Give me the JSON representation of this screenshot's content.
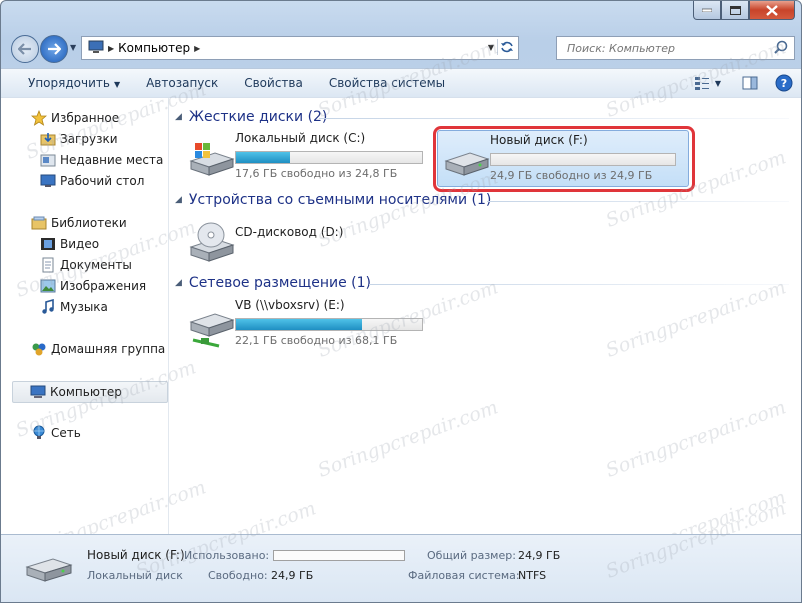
{
  "window": {
    "minimize_icon": "minimize-icon",
    "maximize_icon": "maximize-icon",
    "close_icon": "close-icon"
  },
  "address_bar": {
    "path": [
      "Компьютер"
    ],
    "search_placeholder": "Поиск: Компьютер"
  },
  "toolbar": {
    "organize": "Упорядочить",
    "autoplay": "Автозапуск",
    "properties": "Свойства",
    "system_properties": "Свойства системы"
  },
  "nav": {
    "favorites": "Избранное",
    "downloads": "Загрузки",
    "recent_places": "Недавние места",
    "desktop": "Рабочий стол",
    "libraries": "Библиотеки",
    "video": "Видео",
    "documents": "Документы",
    "pictures": "Изображения",
    "music": "Музыка",
    "homegroup": "Домашняя группа",
    "computer": "Компьютер",
    "network": "Сеть"
  },
  "groups": {
    "hard_disks": {
      "title": "Жесткие диски (2)",
      "drives": [
        {
          "name": "Локальный диск (C:)",
          "free_text": "17,6 ГБ свободно из 24,8 ГБ",
          "used_fraction": 0.29
        },
        {
          "name": "Новый диск (F:)",
          "free_text": "24,9 ГБ свободно из 24,9 ГБ",
          "used_fraction": 0.0
        }
      ]
    },
    "removable": {
      "title": "Устройства со съемными носителями (1)",
      "drives": [
        {
          "name": "CD-дисковод (D:)"
        }
      ]
    },
    "network": {
      "title": "Сетевое размещение (1)",
      "drives": [
        {
          "name": "VB (\\\\vboxsrv) (E:)",
          "free_text": "22,1 ГБ свободно из 68,1 ГБ",
          "used_fraction": 0.68
        }
      ]
    }
  },
  "details": {
    "name": "Новый диск (F:)",
    "type": "Локальный диск",
    "used_label": "Использовано:",
    "free_label": "Свободно:",
    "free_value": "24,9 ГБ",
    "total_label": "Общий размер:",
    "total_value": "24,9 ГБ",
    "fs_label": "Файловая система:",
    "fs_value": "NTFS",
    "used_fraction": 0.0
  },
  "watermark": "Soringpcrepair.com"
}
